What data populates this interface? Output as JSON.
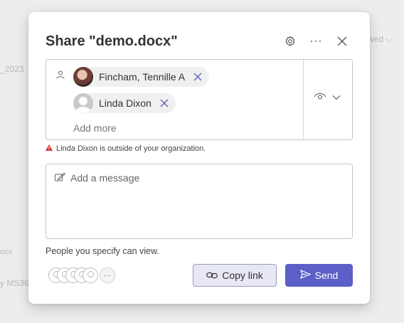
{
  "background": {
    "viewed_text": "wed",
    "year_text": "_2023",
    "docx_text": "ocx",
    "ms_text": "y MS36"
  },
  "dialog": {
    "title": "Share \"demo.docx\"",
    "recipients": [
      {
        "name": "Fincham, Tennille A",
        "avatar": "photo"
      },
      {
        "name": "Linda Dixon",
        "avatar": "default"
      }
    ],
    "add_more_placeholder": "Add more",
    "warning": "Linda Dixon is outside of your organization.",
    "message_placeholder": "Add a message",
    "people_note": "People you specify can view.",
    "more_avatars_label": "···",
    "copy_link_label": "Copy link",
    "send_label": "Send"
  },
  "colors": {
    "accent": "#5b5fc7",
    "warning": "#d13438",
    "copy_bg": "#e7e7f5"
  },
  "icons": [
    "gear-icon",
    "more-icon",
    "close-icon",
    "person-icon",
    "remove-icon",
    "view-eye-icon",
    "chevron-down-icon",
    "warning-icon",
    "edit-message-icon",
    "link-icon",
    "send-icon"
  ]
}
